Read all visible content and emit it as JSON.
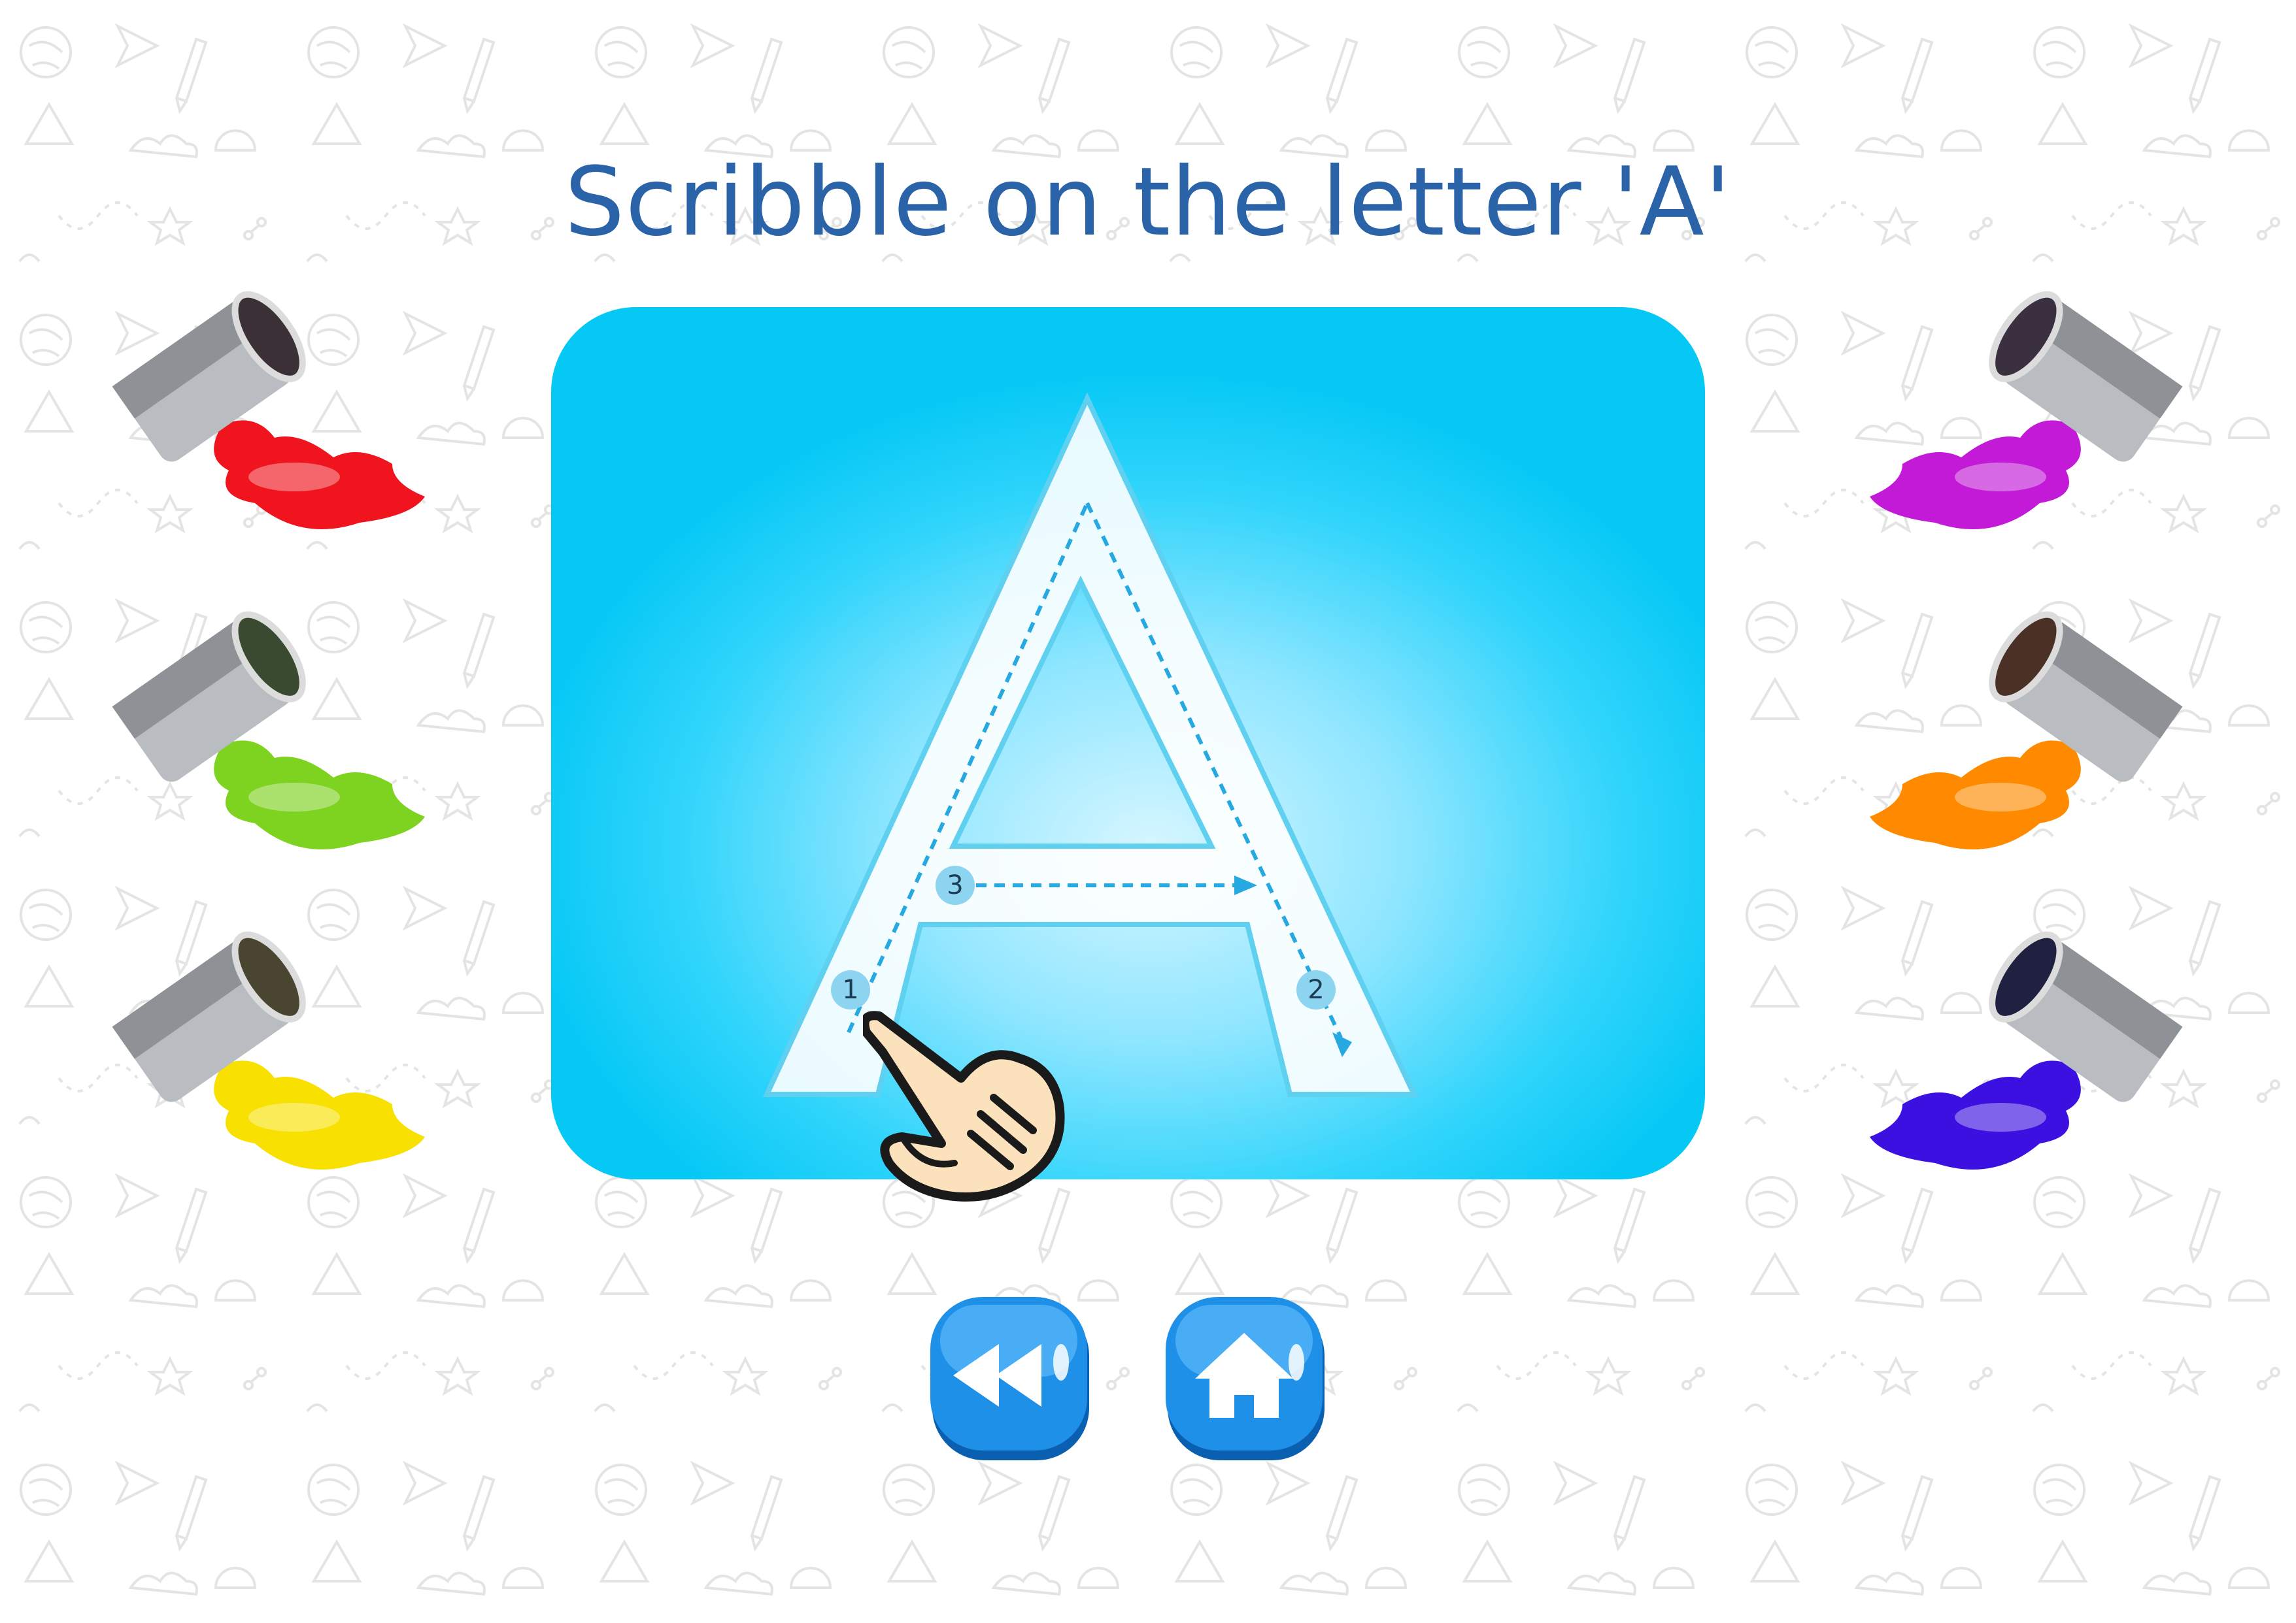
{
  "title": "Scribble on the letter 'A'",
  "letter": {
    "value": "A",
    "stroke_numbers": [
      "1",
      "2",
      "3"
    ]
  },
  "paint_colors": {
    "left": [
      {
        "name": "red",
        "color": "#f0141e"
      },
      {
        "name": "green",
        "color": "#7ed321"
      },
      {
        "name": "yellow",
        "color": "#f8e000"
      }
    ],
    "right": [
      {
        "name": "magenta",
        "color": "#c21ad6"
      },
      {
        "name": "orange",
        "color": "#ff8a00"
      },
      {
        "name": "violet",
        "color": "#3c10e0"
      }
    ]
  },
  "buttons": [
    {
      "name": "rewind-button",
      "icon": "rewind-icon"
    },
    {
      "name": "home-button",
      "icon": "home-icon"
    }
  ],
  "theme": {
    "title_color": "#2a63a8",
    "board_color": "#05c8f5",
    "button_color": "#1e90e8"
  }
}
